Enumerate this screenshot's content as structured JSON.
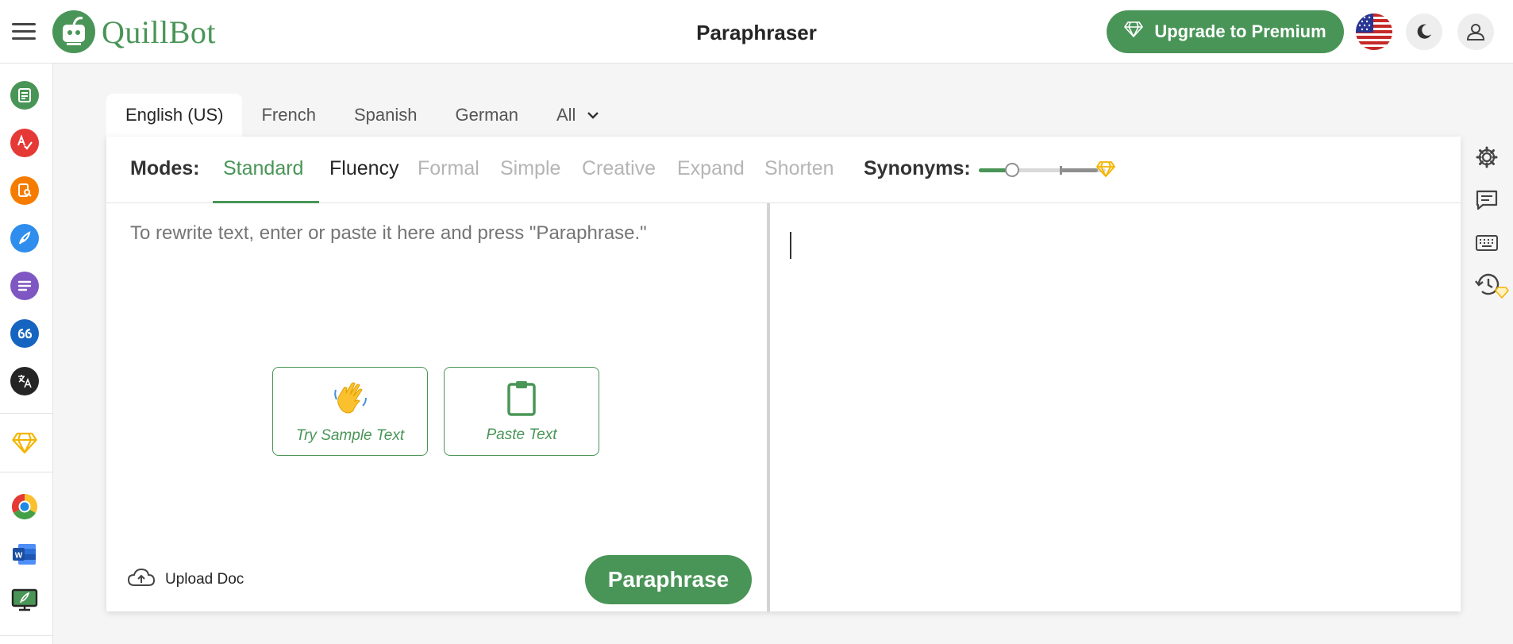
{
  "header": {
    "menu_icon": "hamburger-menu-icon",
    "logo_text": "QuillBot",
    "title": "Paraphraser",
    "upgrade_label": "Upgrade to Premium",
    "upgrade_icon": "diamond-icon",
    "language_flag": "us-flag-icon",
    "theme_icon": "moon-icon",
    "account_icon": "user-icon"
  },
  "sidebar": {
    "items": [
      {
        "name": "paraphraser-icon",
        "color": "#499557"
      },
      {
        "name": "grammar-checker-icon",
        "color": "#e53935"
      },
      {
        "name": "plagiarism-checker-icon",
        "color": "#f57c00"
      },
      {
        "name": "co-writer-icon",
        "color": "#2f8ded"
      },
      {
        "name": "summarizer-icon",
        "color": "#7e57c2"
      },
      {
        "name": "citation-generator-icon",
        "color": "#1565c0"
      },
      {
        "name": "translator-icon",
        "color": "#252525"
      }
    ],
    "premium_icon": "diamond-icon",
    "extensions": [
      "chrome-icon",
      "word-icon",
      "desktop-app-icon"
    ]
  },
  "languages": {
    "tabs": [
      "English (US)",
      "French",
      "Spanish",
      "German",
      "All"
    ],
    "active": "English (US)"
  },
  "modes": {
    "label": "Modes:",
    "items": [
      {
        "label": "Standard",
        "state": "active"
      },
      {
        "label": "Fluency",
        "state": "enabled"
      },
      {
        "label": "Formal",
        "state": "locked"
      },
      {
        "label": "Simple",
        "state": "locked"
      },
      {
        "label": "Creative",
        "state": "locked"
      },
      {
        "label": "Expand",
        "state": "locked"
      },
      {
        "label": "Shorten",
        "state": "locked"
      }
    ]
  },
  "synonyms": {
    "label": "Synonyms:",
    "level": 0.35,
    "premium_icon": "diamond-icon"
  },
  "input": {
    "placeholder": "To rewrite text, enter or paste it here and press \"Paraphrase.\"",
    "sample_button": "Try Sample Text",
    "paste_button": "Paste Text"
  },
  "footer": {
    "upload_label": "Upload Doc",
    "paraphrase_label": "Paraphrase"
  },
  "right_tools": [
    "settings-icon",
    "feedback-icon",
    "keyboard-icon",
    "history-icon"
  ],
  "colors": {
    "brand": "#499557",
    "premium": "#f4b400"
  }
}
